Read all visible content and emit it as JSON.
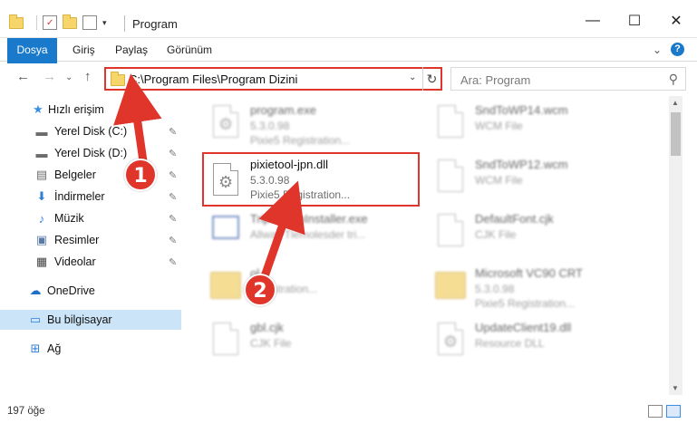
{
  "window": {
    "title": "Program",
    "minimize_glyph": "—",
    "maximize_glyph": "☐",
    "close_glyph": "✕"
  },
  "ribbon": {
    "tabs": [
      "Dosya",
      "Giriş",
      "Paylaş",
      "Görünüm"
    ],
    "help_glyph": "?",
    "expand_glyph": "⌄"
  },
  "nav": {
    "back_glyph": "←",
    "forward_glyph": "→",
    "recent_glyph": "⌄",
    "up_glyph": "↑"
  },
  "address": {
    "path": "C:\\Program Files\\Program Dizini",
    "dropdown_glyph": "⌄",
    "refresh_glyph": "↻"
  },
  "search": {
    "placeholder": "Ara: Program",
    "icon_glyph": "⚲"
  },
  "sidebar": {
    "items": [
      {
        "label": "Hızlı erişim",
        "icon": "star-icon",
        "glyph": "★",
        "color": "#3a8ee6"
      },
      {
        "label": "Yerel Disk (C:)",
        "icon": "drive-icon",
        "glyph": "▬",
        "color": "#6b6b6b"
      },
      {
        "label": "Yerel Disk (D:)",
        "icon": "drive-icon",
        "glyph": "▬",
        "color": "#6b6b6b"
      },
      {
        "label": "Belgeler",
        "icon": "documents-icon",
        "glyph": "▤",
        "color": "#6b6b6b"
      },
      {
        "label": "İndirmeler",
        "icon": "download-icon",
        "glyph": "⬇",
        "color": "#2f7fd6"
      },
      {
        "label": "Müzik",
        "icon": "music-icon",
        "glyph": "♪",
        "color": "#2f7fd6"
      },
      {
        "label": "Resimler",
        "icon": "pictures-icon",
        "glyph": "▣",
        "color": "#5a7aa8"
      },
      {
        "label": "Videolar",
        "icon": "videos-icon",
        "glyph": "▦",
        "color": "#444444"
      },
      {
        "label": "OneDrive",
        "icon": "onedrive-icon",
        "glyph": "☁",
        "color": "#1f6fc6"
      },
      {
        "label": "Bu bilgisayar",
        "icon": "computer-icon",
        "glyph": "▭",
        "color": "#2f7fd6"
      },
      {
        "label": "Ağ",
        "icon": "network-icon",
        "glyph": "⊞",
        "color": "#2f7fd6"
      }
    ],
    "pin_glyph": "📌"
  },
  "files": {
    "left": [
      {
        "name": "program.exe",
        "line2": "5.3.0.98",
        "line3": "Pixie5 Registration..."
      },
      {
        "name": "TripleMsmInstaller.exe",
        "line2": "Allway Tlemolesder tri...",
        "line3": ""
      },
      {
        "name": "ol.",
        "line2": "Registration...",
        "line3": ""
      },
      {
        "name": "gbl.cjk",
        "line2": "CJK File",
        "line3": ""
      }
    ],
    "right": [
      {
        "name": "SndToWP14.wcm",
        "line2": "WCM File",
        "line3": ""
      },
      {
        "name": "SndToWP12.wcm",
        "line2": "WCM File",
        "line3": ""
      },
      {
        "name": "DefaultFont.cjk",
        "line2": "CJK File",
        "line3": ""
      },
      {
        "name": "Microsoft VC90 CRT",
        "line2": "5.3.0.98",
        "line3": "Pixie5 Registration..."
      },
      {
        "name": "UpdateClient19.dll",
        "line2": "Resource DLL",
        "line3": ""
      }
    ],
    "highlighted": {
      "name": "pixietool-jpn.dll",
      "line2": "5.3.0.98",
      "line3": "Pixie5 Registration..."
    }
  },
  "status": {
    "count": "197 öğe"
  },
  "callouts": [
    "1",
    "2"
  ],
  "colors": {
    "accent": "#1979ca",
    "highlight_red": "#e0352b",
    "selection": "#cce4f7"
  }
}
